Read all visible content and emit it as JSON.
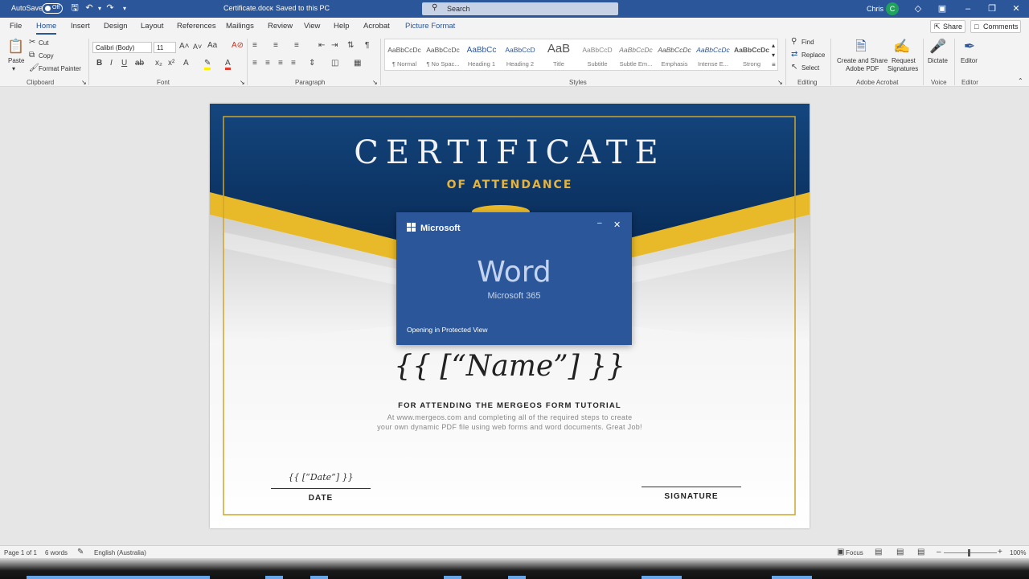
{
  "titlebar": {
    "autosave_label": "AutoSave",
    "autosave_state": "Off",
    "doc_title": "Certificate.docx",
    "save_status": "Saved to this PC",
    "search_placeholder": "Search",
    "user_name": "Chris",
    "user_initial": "C"
  },
  "menu": {
    "tabs": [
      "File",
      "Home",
      "Insert",
      "Design",
      "Layout",
      "References",
      "Mailings",
      "Review",
      "View",
      "Help",
      "Acrobat",
      "Picture Format"
    ],
    "active_tab": "Home",
    "share": "Share",
    "comments": "Comments"
  },
  "ribbon": {
    "clipboard": {
      "paste": "Paste",
      "cut": "Cut",
      "copy": "Copy",
      "format_painter": "Format Painter",
      "label": "Clipboard"
    },
    "font": {
      "family": "Calibri (Body)",
      "size": "11",
      "label": "Font"
    },
    "paragraph": {
      "label": "Paragraph"
    },
    "styles": {
      "label": "Styles",
      "items": [
        {
          "sample": "AaBbCcDc",
          "name": "¶ Normal"
        },
        {
          "sample": "AaBbCcDc",
          "name": "¶ No Spac..."
        },
        {
          "sample": "AaBbCc",
          "name": "Heading 1"
        },
        {
          "sample": "AaBbCcD",
          "name": "Heading 2"
        },
        {
          "sample": "AaB",
          "name": "Title"
        },
        {
          "sample": "AaBbCcD",
          "name": "Subtitle"
        },
        {
          "sample": "AaBbCcDc",
          "name": "Subtle Em..."
        },
        {
          "sample": "AaBbCcDc",
          "name": "Emphasis"
        },
        {
          "sample": "AaBbCcDc",
          "name": "Intense E..."
        },
        {
          "sample": "AaBbCcDc",
          "name": "Strong"
        }
      ]
    },
    "editing": {
      "find": "Find",
      "replace": "Replace",
      "select": "Select",
      "label": "Editing"
    },
    "acrobat": {
      "create_share": "Create and Share",
      "adobe_pdf": "Adobe PDF",
      "request": "Request",
      "signatures": "Signatures",
      "label": "Adobe Acrobat"
    },
    "voice": {
      "dictate": "Dictate",
      "label": "Voice"
    },
    "editor": {
      "editor": "Editor",
      "label": "Editor"
    }
  },
  "certificate": {
    "title": "CERTIFICATE",
    "subtitle": "OF ATTENDANCE",
    "name_field": "{{ [“Name”] }}",
    "attending_line": "FOR ATTENDING THE MERGEOS FORM TUTORIAL",
    "body_line_1": "At www.mergeos.com and completing all of the required steps to create",
    "body_line_2": "your own dynamic PDF file using web forms and word documents. Great Job!",
    "date_field": "{{ [“Date”] }}",
    "date_label": "DATE",
    "signature_label": "SIGNATURE",
    "colors": {
      "navy": "#0b2d5e",
      "gold": "#e8b929",
      "border_gold": "#d1a528"
    }
  },
  "splash": {
    "brand": "Microsoft",
    "product": "Word",
    "suite": "Microsoft 365",
    "status": "Opening in Protected View",
    "color": "#2b579a"
  },
  "statusbar": {
    "page": "Page 1 of 1",
    "words": "6 words",
    "language": "English (Australia)",
    "focus": "Focus",
    "zoom": "100%"
  }
}
